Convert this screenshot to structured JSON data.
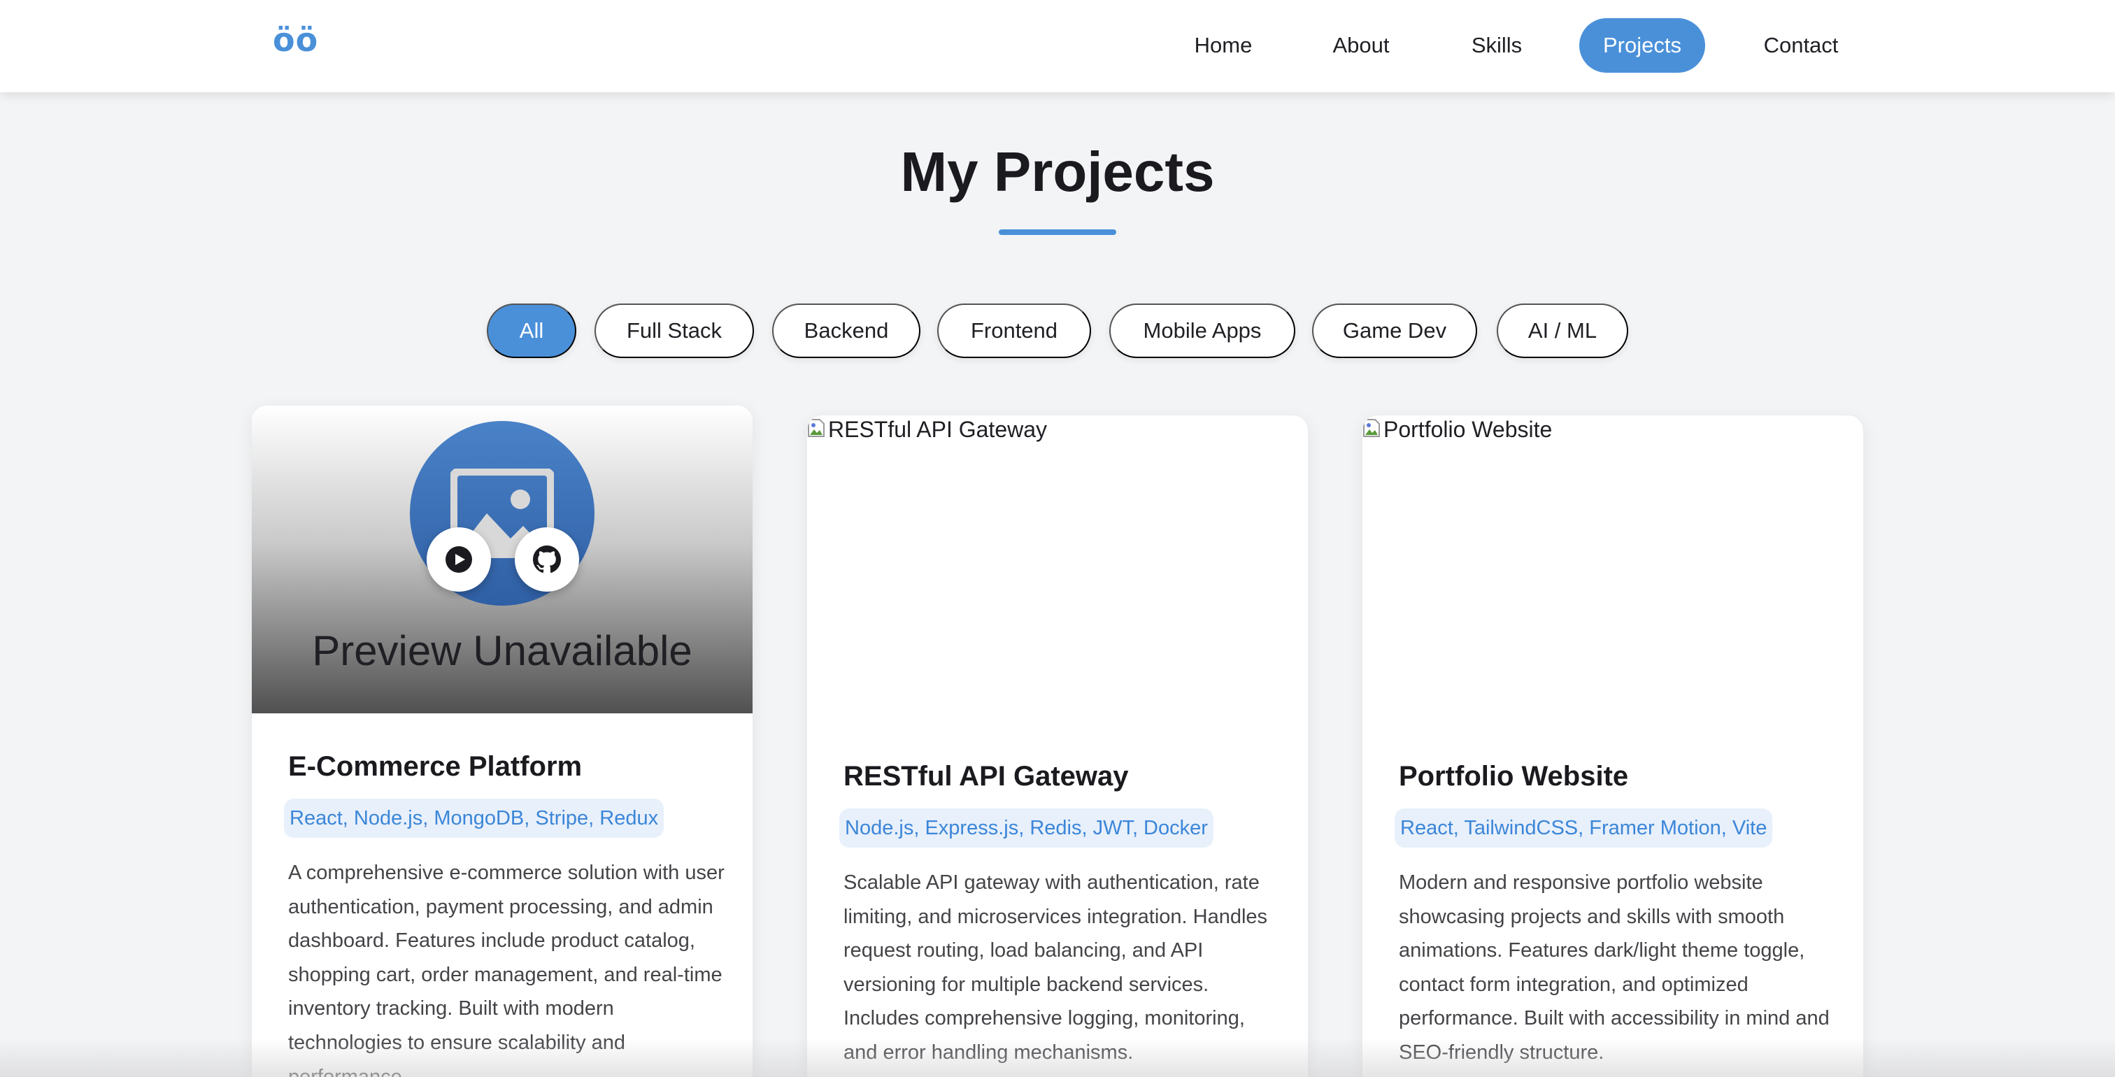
{
  "logo": "öö",
  "nav": {
    "items": [
      {
        "label": "Home"
      },
      {
        "label": "About"
      },
      {
        "label": "Skills"
      },
      {
        "label": "Projects",
        "active": true
      },
      {
        "label": "Contact"
      }
    ]
  },
  "page": {
    "title": "My Projects"
  },
  "filters": [
    {
      "label": "All",
      "active": true
    },
    {
      "label": "Full Stack"
    },
    {
      "label": "Backend"
    },
    {
      "label": "Frontend"
    },
    {
      "label": "Mobile Apps"
    },
    {
      "label": "Game Dev"
    },
    {
      "label": "AI / ML"
    }
  ],
  "projects": [
    {
      "title": "E-Commerce Platform",
      "tech": "React, Node.js, MongoDB, Stripe, Redux",
      "description": "A comprehensive e-commerce solution with user authentication, payment processing, and admin dashboard. Features include product catalog, shopping cart, order management, and real-time inventory tracking. Built with modern technologies to ensure scalability and performance.",
      "preview_text": "Preview Unavailable"
    },
    {
      "title": "RESTful API Gateway",
      "tech": "Node.js, Express.js, Redis, JWT, Docker",
      "description": "Scalable API gateway with authentication, rate limiting, and microservices integration. Handles request routing, load balancing, and API versioning for multiple backend services. Includes comprehensive logging, monitoring, and error handling mechanisms.",
      "image_alt": "RESTful API Gateway"
    },
    {
      "title": "Portfolio Website",
      "tech": "React, TailwindCSS, Framer Motion, Vite",
      "description": "Modern and responsive portfolio website showcasing projects and skills with smooth animations. Features dark/light theme toggle, contact form integration, and optimized performance. Built with accessibility in mind and SEO-friendly structure.",
      "image_alt": "Portfolio Website"
    }
  ],
  "colors": {
    "accent": "#4a90d9",
    "tag_bg": "#e8f0fb",
    "tag_text": "#3b86d8",
    "page_bg": "#f3f4f6"
  },
  "icons": [
    "image-icon",
    "play-icon",
    "github-icon",
    "broken-image-icon"
  ]
}
